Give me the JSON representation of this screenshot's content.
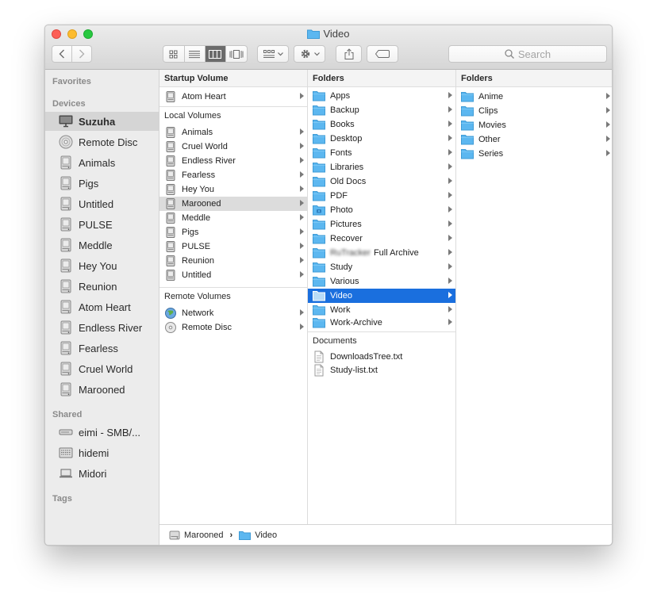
{
  "window": {
    "title": "Video"
  },
  "toolbar": {
    "search_placeholder": "Search"
  },
  "sidebar": {
    "favorites_label": "Favorites",
    "devices_label": "Devices",
    "devices": [
      {
        "label": "Suzuha",
        "icon": "computer-icon"
      },
      {
        "label": "Remote Disc",
        "icon": "disc-icon"
      },
      {
        "label": "Animals",
        "icon": "drive-icon"
      },
      {
        "label": "Pigs",
        "icon": "drive-icon"
      },
      {
        "label": "Untitled",
        "icon": "drive-icon"
      },
      {
        "label": "PULSE",
        "icon": "drive-icon"
      },
      {
        "label": "Meddle",
        "icon": "drive-icon"
      },
      {
        "label": "Hey You",
        "icon": "drive-icon"
      },
      {
        "label": "Reunion",
        "icon": "drive-icon"
      },
      {
        "label": "Atom Heart",
        "icon": "drive-icon"
      },
      {
        "label": "Endless River",
        "icon": "drive-icon"
      },
      {
        "label": "Fearless",
        "icon": "drive-icon"
      },
      {
        "label": "Cruel World",
        "icon": "drive-icon"
      },
      {
        "label": "Marooned",
        "icon": "drive-icon"
      }
    ],
    "shared_label": "Shared",
    "shared": [
      {
        "label": "eimi - SMB/...",
        "icon": "network-drive-icon"
      },
      {
        "label": "hidemi",
        "icon": "server-icon"
      },
      {
        "label": "Midori",
        "icon": "laptop-icon"
      }
    ],
    "tags_label": "Tags"
  },
  "col1": {
    "header": "Startup Volume",
    "startup": [
      "Atom Heart"
    ],
    "local_label": "Local Volumes",
    "local": [
      "Animals",
      "Cruel World",
      "Endless River",
      "Fearless",
      "Hey You",
      "Marooned",
      "Meddle",
      "Pigs",
      "PULSE",
      "Reunion",
      "Untitled"
    ],
    "remote_label": "Remote Volumes",
    "remote": [
      "Network",
      "Remote Disc"
    ]
  },
  "col2": {
    "header": "Folders",
    "folders": [
      "Apps",
      "Backup",
      "Books",
      "Desktop",
      "Fonts",
      "Libraries",
      "Old Docs",
      "PDF",
      "Photo",
      "Pictures",
      "Recover",
      "RuTracker",
      "Full Archive",
      "Study",
      "Various",
      "Video",
      "Work",
      "Work-Archive"
    ],
    "documents_label": "Documents",
    "documents": [
      "DownloadsTree.txt",
      "Study-list.txt"
    ]
  },
  "col3": {
    "header": "Folders",
    "folders": [
      "Anime",
      "Clips",
      "Movies",
      "Other",
      "Series"
    ]
  },
  "pathbar": {
    "items": [
      "Marooned",
      "Video"
    ],
    "separator": "›"
  },
  "colors": {
    "selection": "#1a6fde",
    "folder": "#5cb7f0",
    "sidebar_bg": "#ececec"
  }
}
